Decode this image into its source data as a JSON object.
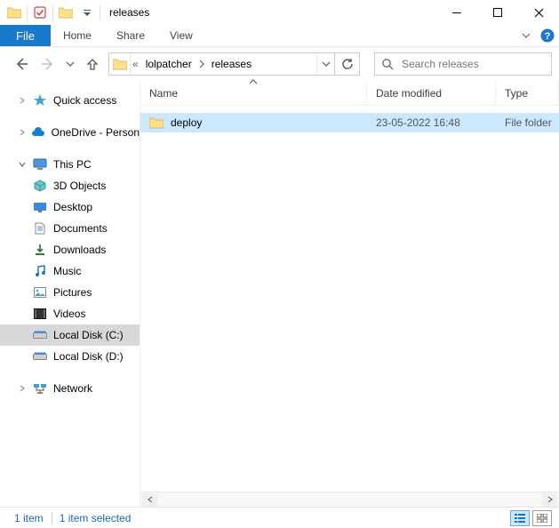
{
  "window": {
    "title": "releases"
  },
  "menutabs": {
    "file": "File",
    "home": "Home",
    "share": "Share",
    "view": "View"
  },
  "address": {
    "parent": "lolpatcher",
    "current": "releases"
  },
  "search": {
    "placeholder": "Search releases"
  },
  "tree": {
    "quick_access": "Quick access",
    "onedrive": "OneDrive - Person",
    "this_pc": "This PC",
    "children": {
      "objects_3d": "3D Objects",
      "desktop": "Desktop",
      "documents": "Documents",
      "downloads": "Downloads",
      "music": "Music",
      "pictures": "Pictures",
      "videos": "Videos",
      "local_c": "Local Disk (C:)",
      "local_d": "Local Disk (D:)"
    },
    "network": "Network"
  },
  "columns": {
    "name": "Name",
    "date": "Date modified",
    "type": "Type"
  },
  "rows": [
    {
      "name": "deploy",
      "date": "23-05-2022 16:48",
      "type": "File folder"
    }
  ],
  "status": {
    "count": "1 item",
    "selected": "1 item selected"
  }
}
